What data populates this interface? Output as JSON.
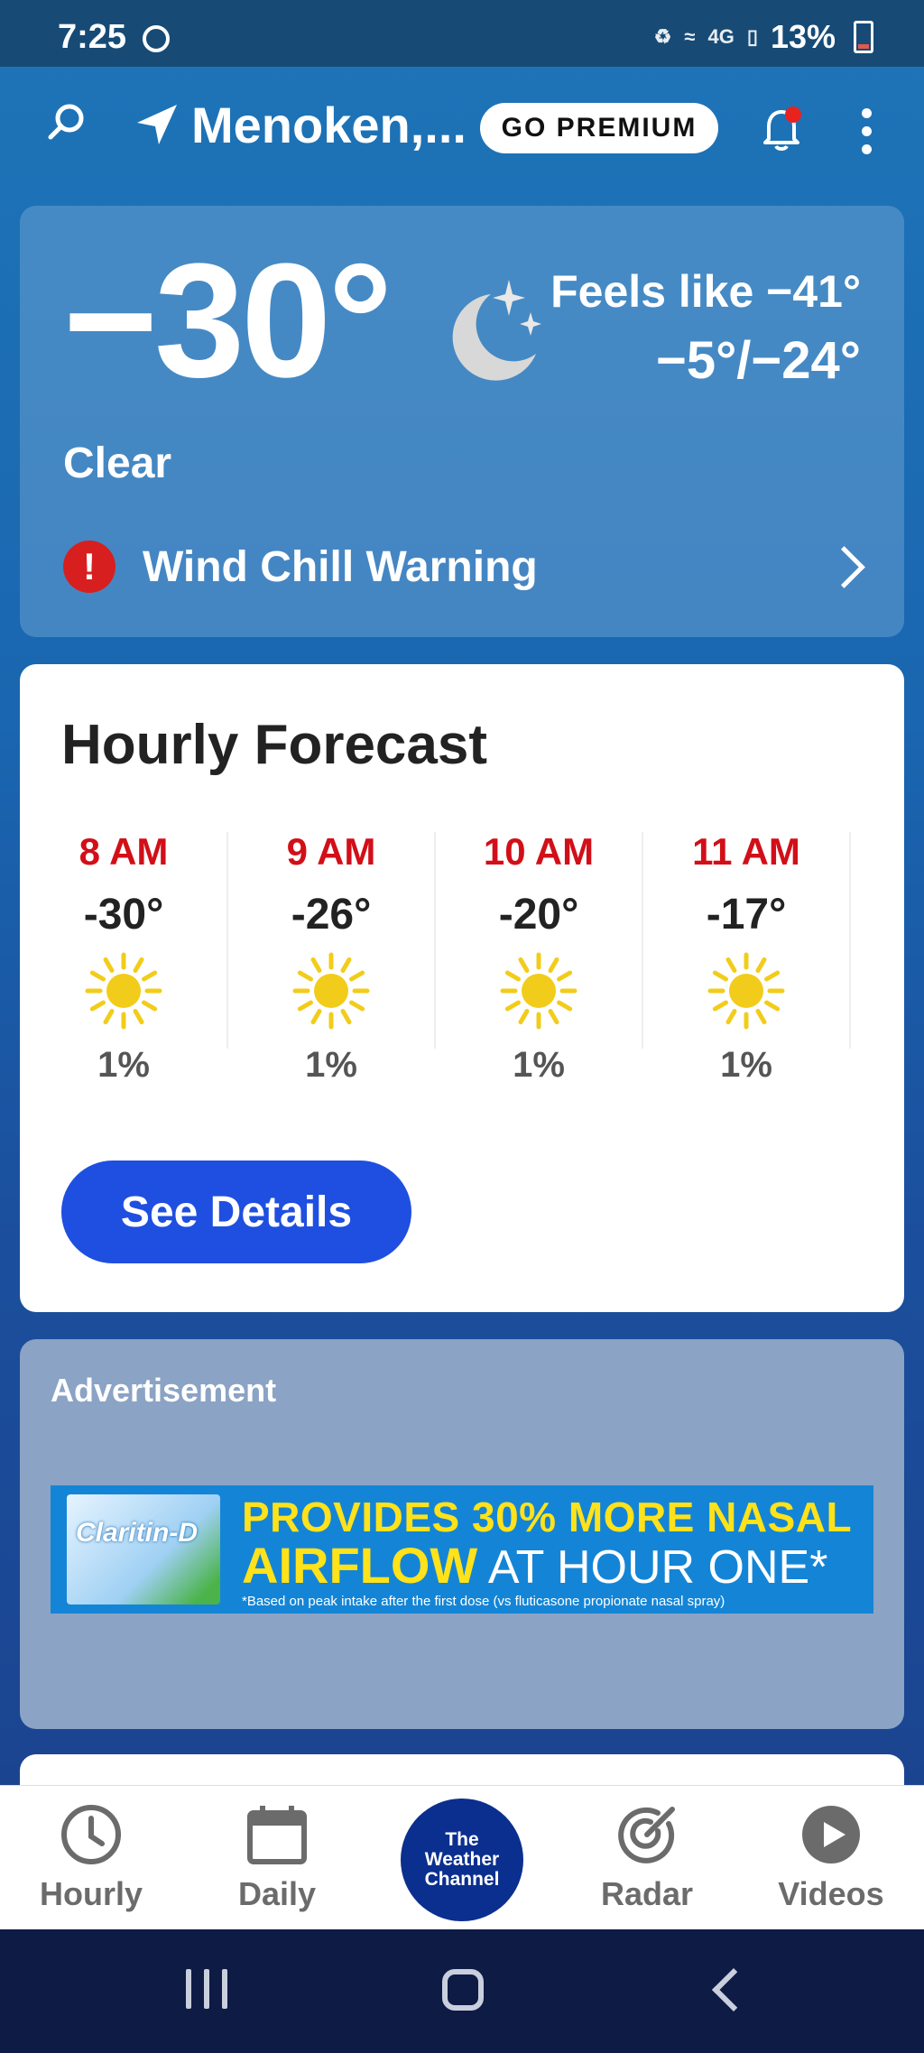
{
  "status_bar": {
    "time": "7:25",
    "network": "4G",
    "battery": "13%"
  },
  "header": {
    "location": "Menoken,...",
    "premium_label": "GO PREMIUM"
  },
  "current": {
    "temperature": "−30°",
    "feels_like": "Feels like −41°",
    "high_low": "−5°/−24°",
    "condition": "Clear",
    "icon": "clear-night-moon",
    "alert_text": "Wind Chill Warning"
  },
  "hourly": {
    "title": "Hourly Forecast",
    "hours": [
      {
        "time": "8 AM",
        "temp": "-30°",
        "icon": "sunny",
        "precip": "1%"
      },
      {
        "time": "9 AM",
        "temp": "-26°",
        "icon": "sunny",
        "precip": "1%"
      },
      {
        "time": "10 AM",
        "temp": "-20°",
        "icon": "sunny",
        "precip": "1%"
      },
      {
        "time": "11 AM",
        "temp": "-17°",
        "icon": "sunny",
        "precip": "1%"
      }
    ],
    "details_label": "See Details"
  },
  "ad": {
    "label": "Advertisement",
    "brand": "Claritin-D",
    "headline_1": "PROVIDES 30% MORE NASAL",
    "headline_2a": "AIRFLOW",
    "headline_2b": " AT HOUR ONE*",
    "footnote": "*Based on peak intake after the first dose (vs fluticasone propionate nasal spray)"
  },
  "bottom_nav": {
    "hourly": "Hourly",
    "daily": "Daily",
    "logo_line1": "The",
    "logo_line2": "Weather",
    "logo_line3": "Channel",
    "radar": "Radar",
    "videos": "Videos"
  },
  "colors": {
    "accent_red": "#d20f18",
    "button_blue": "#1f4fe0",
    "logo_navy": "#0b2f8f"
  }
}
